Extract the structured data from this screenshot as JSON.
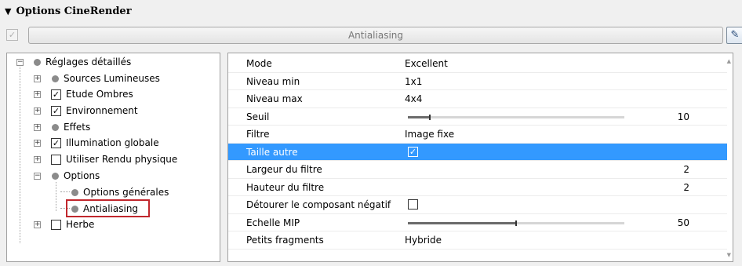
{
  "panel": {
    "collapse_glyph": "▼",
    "title": "Options CineRender"
  },
  "toolbar": {
    "check_glyph": "✓",
    "field_label": "Antialiasing",
    "button_glyph": "✎"
  },
  "tree": {
    "root": {
      "label": "Réglages détaillés",
      "expander": "−"
    },
    "items": [
      {
        "label": "Sources Lumineuses",
        "expander": "+",
        "state": "dot",
        "check_glyph": ""
      },
      {
        "label": "Etude Ombres",
        "expander": "+",
        "state": "checked",
        "check_glyph": "✓"
      },
      {
        "label": "Environnement",
        "expander": "+",
        "state": "checked",
        "check_glyph": "✓"
      },
      {
        "label": "Effets",
        "expander": "+",
        "state": "dot",
        "check_glyph": ""
      },
      {
        "label": "Illumination globale",
        "expander": "+",
        "state": "checked",
        "check_glyph": "✓"
      },
      {
        "label": "Utiliser Rendu physique",
        "expander": "+",
        "state": "unchecked",
        "check_glyph": ""
      },
      {
        "label": "Options",
        "expander": "−",
        "state": "dot",
        "check_glyph": ""
      }
    ],
    "options_children": [
      {
        "label": "Options générales"
      },
      {
        "label": "Antialiasing",
        "selected": true
      }
    ],
    "last": {
      "label": "Herbe",
      "expander": "+",
      "check_glyph": ""
    }
  },
  "properties": [
    {
      "name": "Mode",
      "value": "Excellent"
    },
    {
      "name": "Niveau min",
      "value": "1x1"
    },
    {
      "name": "Niveau max",
      "value": "4x4"
    },
    {
      "name": "Seuil",
      "slider_fraction": 0.1,
      "value": "10"
    },
    {
      "name": "Filtre",
      "value": "Image fixe"
    },
    {
      "name": "Taille autre",
      "check_glyph": "✓",
      "selected": true
    },
    {
      "name": "Largeur du filtre",
      "value": "2"
    },
    {
      "name": "Hauteur du filtre",
      "value": "2"
    },
    {
      "name": "Détourer le composant négatif",
      "check_glyph": ""
    },
    {
      "name": "Echelle MIP",
      "slider_fraction": 0.5,
      "value": "50"
    },
    {
      "name": "Petits fragments",
      "value": "Hybride"
    }
  ],
  "scroll": {
    "up_glyph": "▲",
    "down_glyph": "▼"
  },
  "colors": {
    "selection": "#3399ff",
    "highlight_border": "#c1272d"
  }
}
